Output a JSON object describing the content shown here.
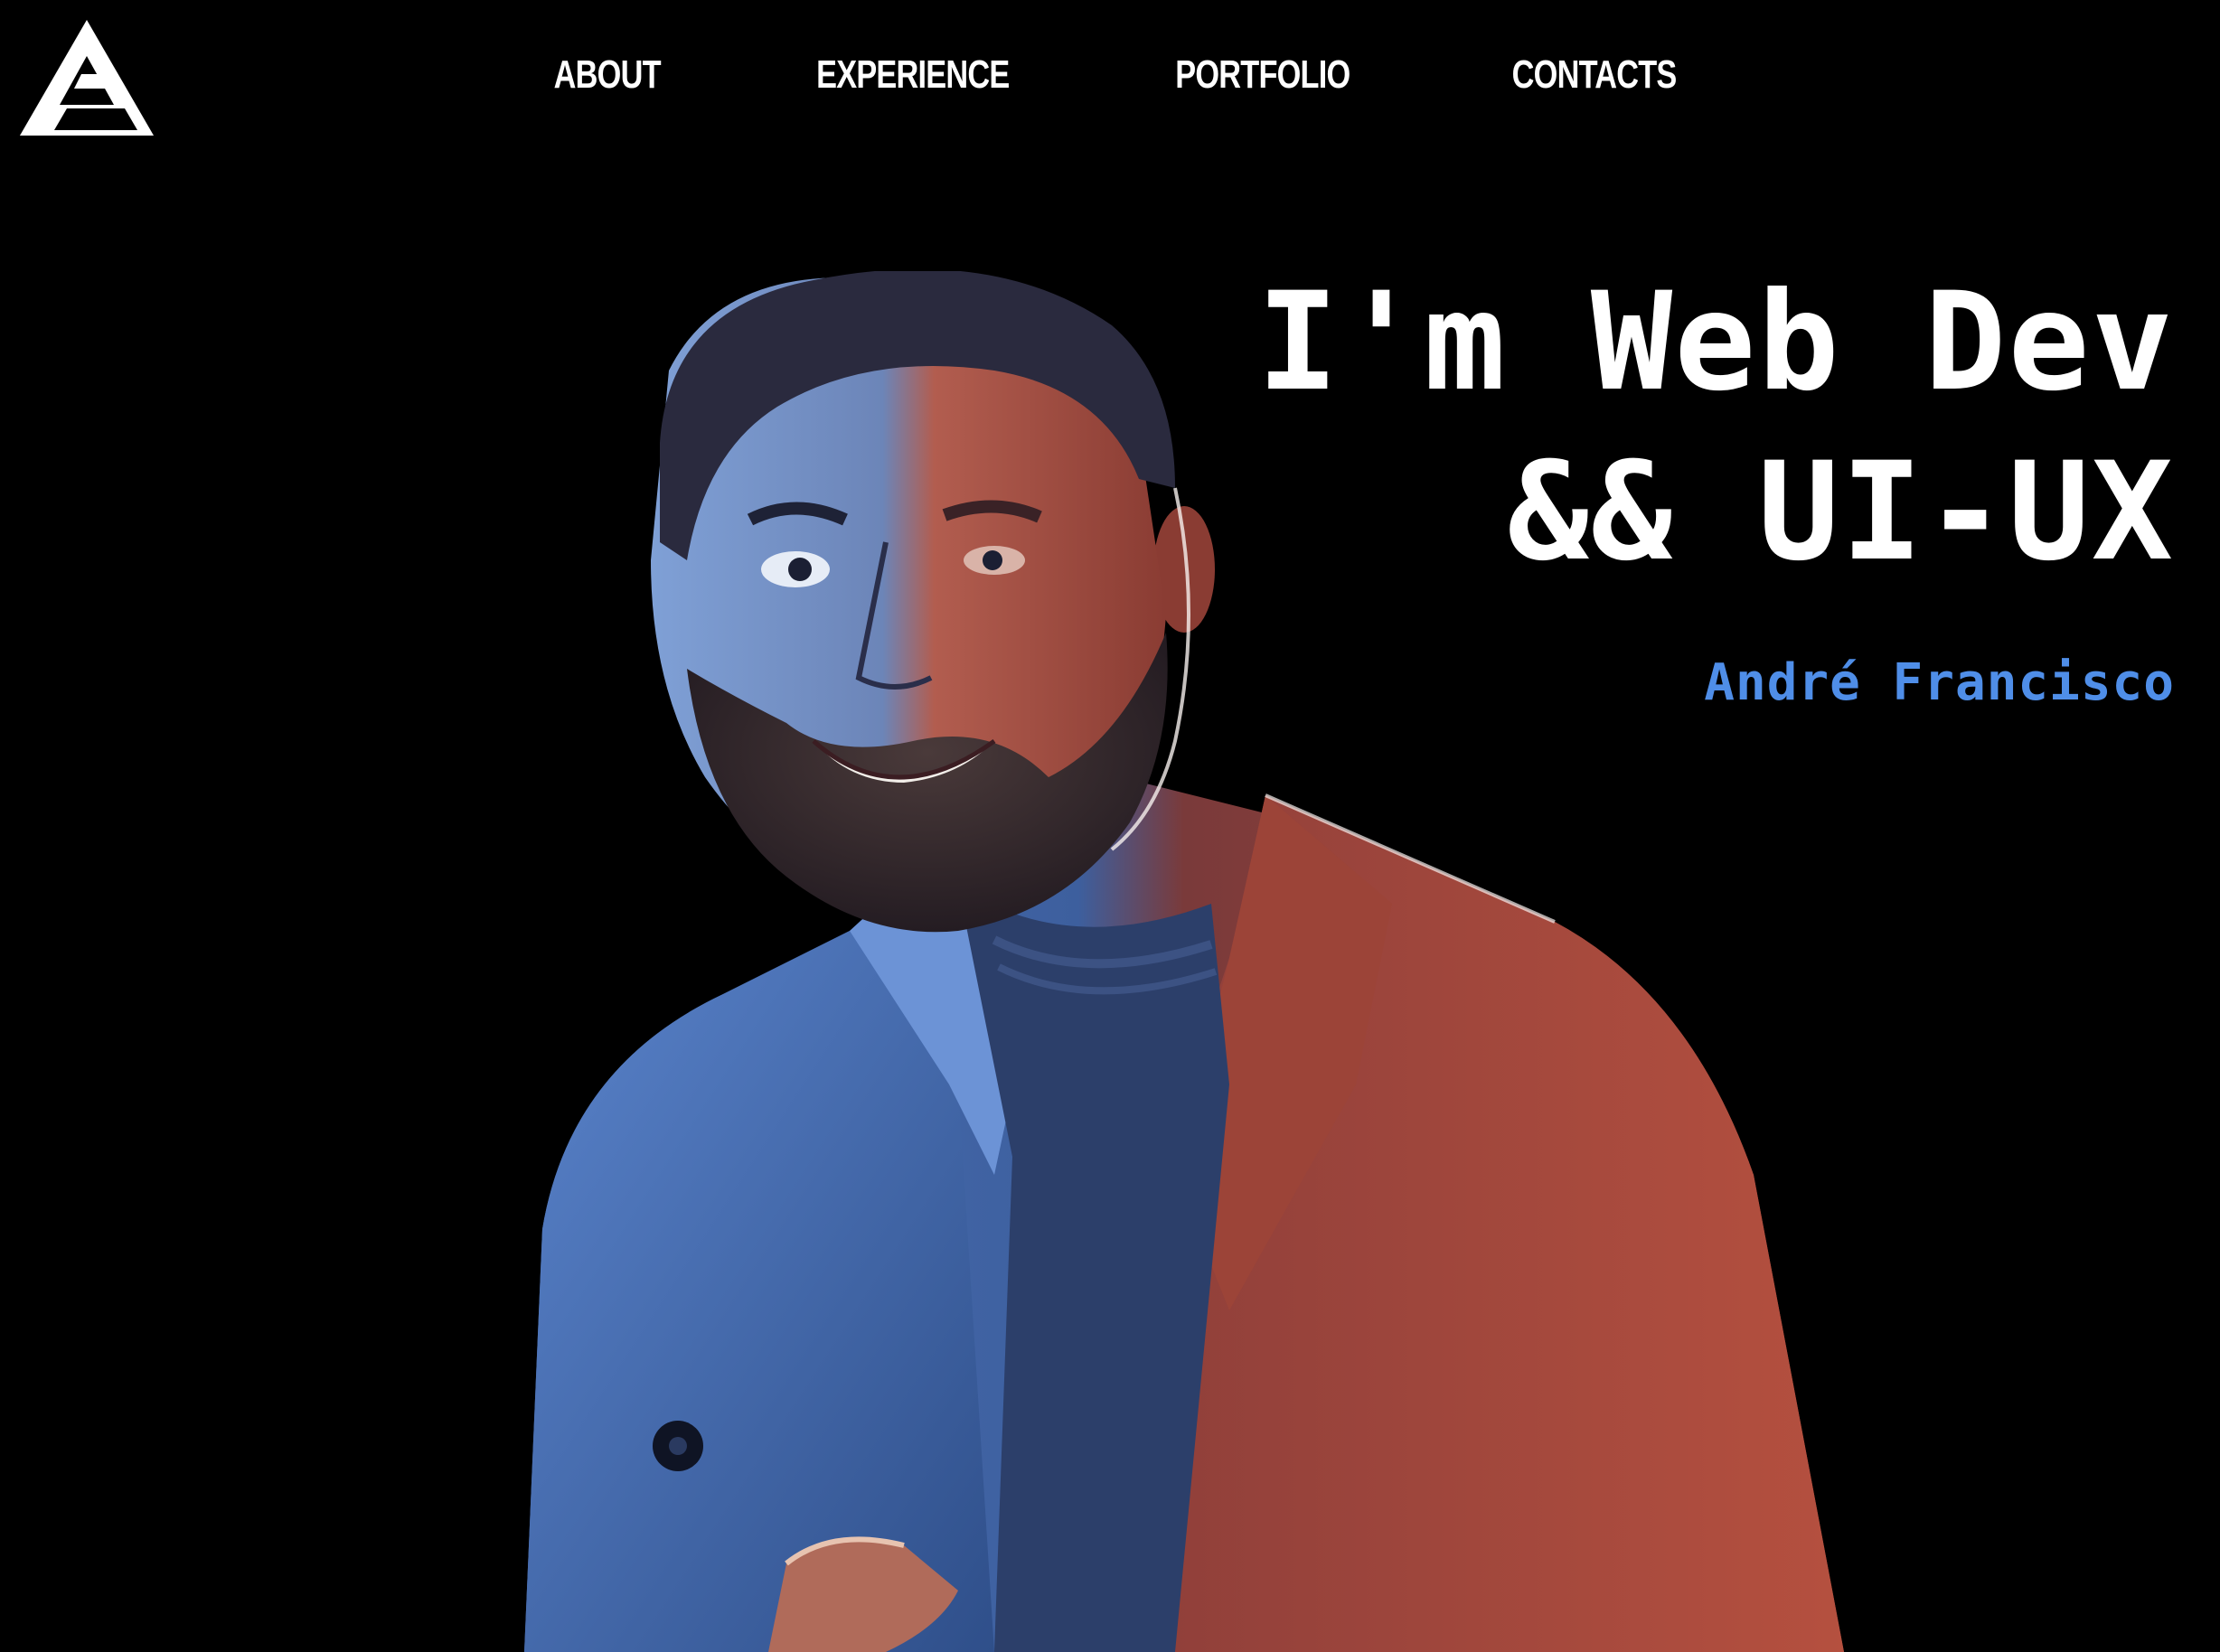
{
  "header": {
    "logo_icon": "brand-triangle-logo-icon",
    "nav": [
      {
        "label": "ABOUT"
      },
      {
        "label": "EXPERIENCE"
      },
      {
        "label": "PORTFOLIO"
      },
      {
        "label": "CONTACTS"
      }
    ]
  },
  "hero": {
    "title_line1": "I'm Web Dev",
    "title_line2": "&& UI-UX",
    "name": "André Francisco"
  },
  "colors": {
    "background": "#000000",
    "text": "#ffffff",
    "accent": "#4f8ee8",
    "light_blue": "#3f6fc4",
    "light_red": "#c24a3f"
  }
}
